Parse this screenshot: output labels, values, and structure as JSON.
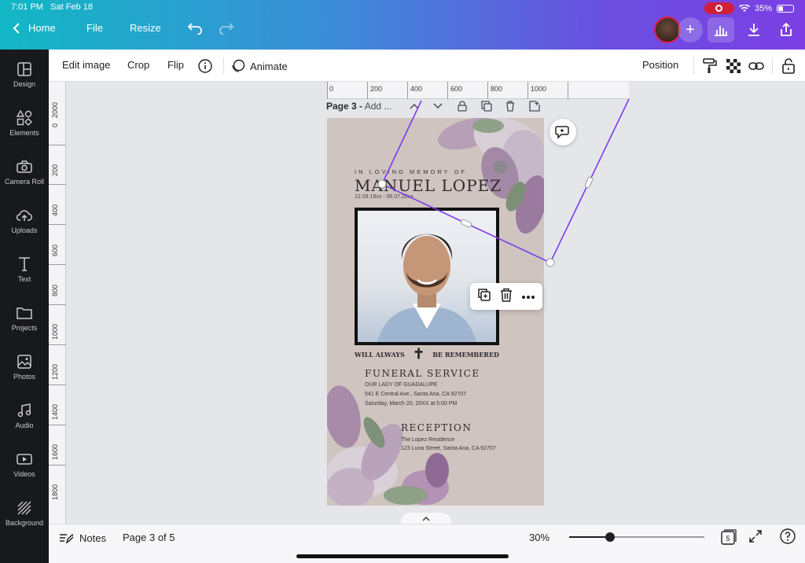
{
  "status_bar": {
    "time": "7:01 PM",
    "date": "Sat Feb 18",
    "battery": "35%",
    "battery_level": 0.35
  },
  "top_nav": {
    "home": "Home",
    "file": "File",
    "resize": "Resize"
  },
  "sidebar": {
    "items": [
      {
        "label": "Design",
        "icon": "layout-icon"
      },
      {
        "label": "Elements",
        "icon": "shapes-icon"
      },
      {
        "label": "Camera Roll",
        "icon": "camera-icon"
      },
      {
        "label": "Uploads",
        "icon": "cloud-upload-icon"
      },
      {
        "label": "Text",
        "icon": "text-icon"
      },
      {
        "label": "Projects",
        "icon": "folder-icon"
      },
      {
        "label": "Photos",
        "icon": "image-icon"
      },
      {
        "label": "Audio",
        "icon": "music-icon"
      },
      {
        "label": "Videos",
        "icon": "video-icon"
      },
      {
        "label": "Background",
        "icon": "hatch-icon"
      }
    ]
  },
  "toolbar": {
    "edit_image": "Edit image",
    "crop": "Crop",
    "flip": "Flip",
    "animate": "Animate",
    "position": "Position"
  },
  "ruler_top": [
    "0",
    "200",
    "400",
    "600",
    "800",
    "1000"
  ],
  "ruler_left": [
    "2000",
    "0",
    "200",
    "400",
    "600",
    "800",
    "1000",
    "1200",
    "1400",
    "1600",
    "1800"
  ],
  "page_header": {
    "label": "Page 3 -",
    "placeholder": "Add ..."
  },
  "card": {
    "kicker": "IN LOVING MEMORY OF",
    "name": "MANUEL LOPEZ",
    "dates": "12.09.19xx - 06.07.20xx",
    "remember_left": "WILL ALWAYS",
    "remember_right": "BE REMEMBERED",
    "service_title": "FUNERAL SERVICE",
    "service_lines": [
      "OUR LADY OF GUADALUPE",
      "541 E Central Ave., Santa Ana, CA 92707",
      "Saturday, March 20, 20XX at 5:00 PM"
    ],
    "reception_title": "RECEPTION",
    "reception_lines": [
      "The Lopez Residence",
      "123 Luna Street, Santa Ana, CA 92707"
    ]
  },
  "bottom_bar": {
    "notes": "Notes",
    "page_status": "Page 3 of 5",
    "zoom": "30%",
    "zoom_level": 0.3,
    "page_count": "5"
  }
}
